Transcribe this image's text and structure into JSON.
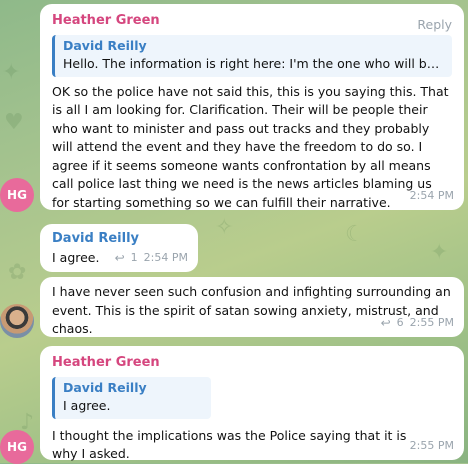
{
  "messages": [
    {
      "sender": "Heather Green",
      "reply_label": "Reply",
      "quote_name": "David Reilly",
      "quote_text": "Hello. The information is right here: I'm the one who will be callin…",
      "text": "OK so the police have not said this, this is you saying this. That is all I am looking for. Clarification. Their will be people their who want to minister and pass out tracks and they probably will attend the event and they have the freedom to do so. I agree if it seems someone wants confrontation by all means call police last thing we need is the news articles blaming us for starting something so we can fulfill their narrative.",
      "time": "2:54 PM",
      "avatar_initials": "HG"
    },
    {
      "sender": "David Reilly",
      "text": "I agree.",
      "reply_count": "1",
      "time": "2:54 PM"
    },
    {
      "text": "I have never seen such confusion and infighting surrounding an event. This is the spirit of satan sowing anxiety, mistrust, and chaos.",
      "reply_count": "6",
      "time": "2:55 PM"
    },
    {
      "sender": "Heather Green",
      "quote_name": "David Reilly",
      "quote_text": "I agree.",
      "text": "I thought the implications was the Police saying that it is why I asked.",
      "time": "2:55 PM",
      "avatar_initials": "HG"
    }
  ],
  "colors": {
    "pink_sender": "#d5467e",
    "blue_sender": "#3a7fc4",
    "avatar_hg": "#e86a9b"
  },
  "icons": {
    "reply_arrow": "reply-arrow-icon"
  }
}
